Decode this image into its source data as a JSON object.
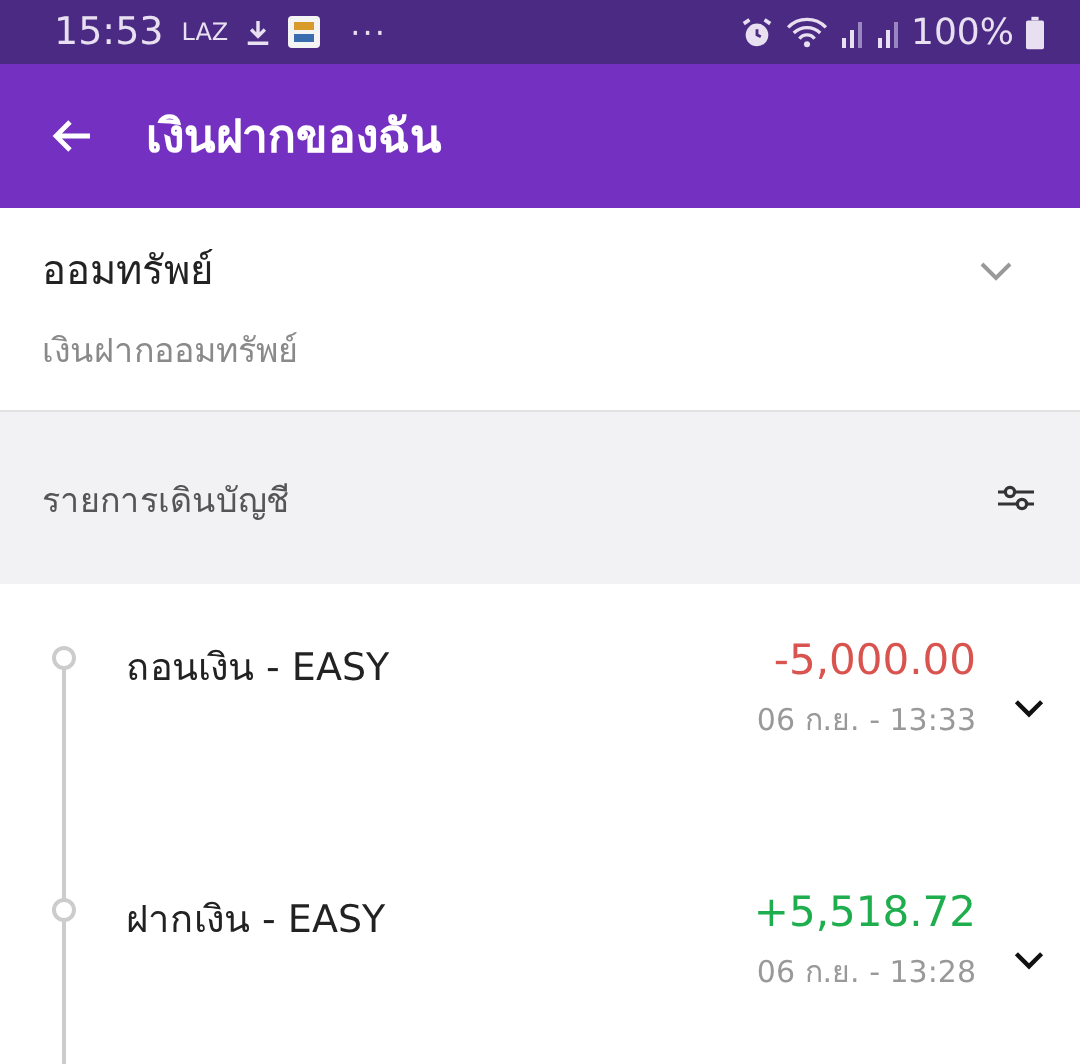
{
  "status_bar": {
    "time": "15:53",
    "notification_label": "LAZ",
    "more": "···",
    "battery": "100%"
  },
  "header": {
    "title": "เงินฝากของฉัน"
  },
  "account": {
    "name": "ออมทรัพย์",
    "type": "เงินฝากออมทรัพย์"
  },
  "section": {
    "title": "รายการเดินบัญชี"
  },
  "transactions": [
    {
      "kind": "withdrawal",
      "title": "ถอนเงิน - EASY",
      "amount": "-5,000.00",
      "datetime": "06 ก.ย. - 13:33"
    },
    {
      "kind": "deposit",
      "title": "ฝากเงิน - EASY",
      "amount": "+5,518.72",
      "datetime": "06 ก.ย. - 13:28"
    }
  ]
}
